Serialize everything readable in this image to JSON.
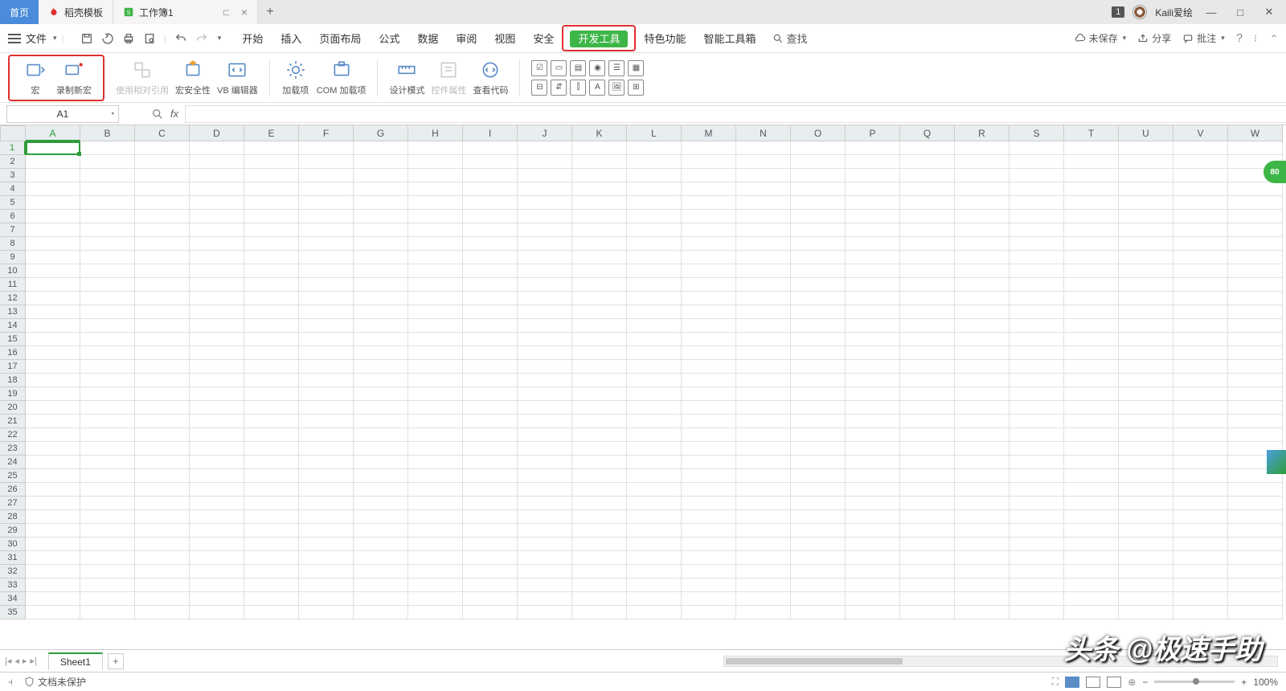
{
  "titlebar": {
    "tabs": [
      {
        "label": "首页",
        "active": true
      },
      {
        "label": "稻壳模板",
        "icon_color": "#e03030"
      },
      {
        "label": "工作簿1",
        "icon_color": "#3db648",
        "closable": true
      }
    ],
    "badge": "1",
    "username": "Kaili爱绘"
  },
  "menubar": {
    "file_label": "文件",
    "tabs": [
      "开始",
      "插入",
      "页面布局",
      "公式",
      "数据",
      "审阅",
      "视图",
      "安全",
      "开发工具",
      "特色功能",
      "智能工具箱"
    ],
    "find_label": "查找",
    "right": {
      "unsaved": "未保存",
      "share": "分享",
      "comment": "批注"
    }
  },
  "ribbon": {
    "macro": "宏",
    "record_macro": "录制新宏",
    "use_relative": "使用相对引用",
    "macro_security": "宏安全性",
    "vb_editor": "VB 编辑器",
    "addins": "加载项",
    "com_addins": "COM 加载项",
    "design_mode": "设计模式",
    "control_props": "控件属性",
    "view_code": "查看代码"
  },
  "formula": {
    "namebox": "A1",
    "fx": "fx"
  },
  "grid": {
    "columns": [
      "A",
      "B",
      "C",
      "D",
      "E",
      "F",
      "G",
      "H",
      "I",
      "J",
      "K",
      "L",
      "M",
      "N",
      "O",
      "P",
      "Q",
      "R",
      "S",
      "T",
      "U",
      "V",
      "W"
    ],
    "rows": 35
  },
  "sheetbar": {
    "sheet": "Sheet1"
  },
  "statusbar": {
    "protect": "文档未保护",
    "zoom": "100%"
  },
  "side": {
    "badge": "80"
  },
  "watermark": "头条 @极速手助"
}
